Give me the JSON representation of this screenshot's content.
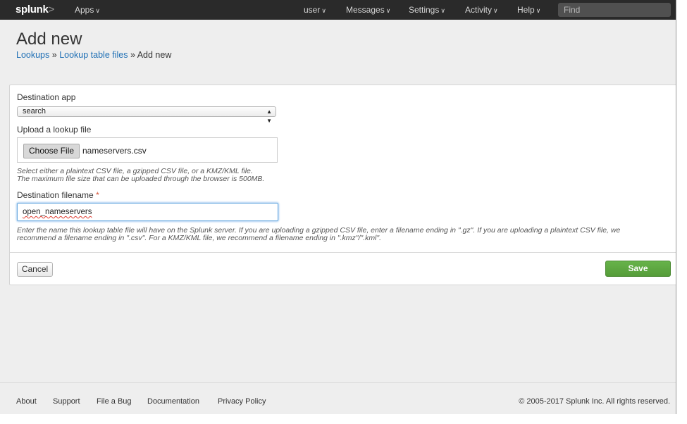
{
  "topbar": {
    "logo": "splunk",
    "logo_mark": ">",
    "nav": [
      {
        "label": "Apps"
      },
      {
        "label": "user"
      },
      {
        "label": "Messages"
      },
      {
        "label": "Settings"
      },
      {
        "label": "Activity"
      },
      {
        "label": "Help"
      }
    ],
    "search_placeholder": "Find"
  },
  "header": {
    "title": "Add new",
    "breadcrumb": [
      {
        "label": "Lookups",
        "link": true
      },
      {
        "label": "Lookup table files",
        "link": true
      },
      {
        "label": "Add new",
        "link": false
      }
    ],
    "separator": "»"
  },
  "form": {
    "destination_app_label": "Destination app",
    "destination_app_value": "search",
    "upload_label": "Upload a lookup file",
    "choose_file_label": "Choose File",
    "chosen_file": "nameservers.csv",
    "upload_help_1": "Select either a plaintext CSV file, a gzipped CSV file, or a KMZ/KML file.",
    "upload_help_2": "The maximum file size that can be uploaded through the browser is 500MB.",
    "filename_label": "Destination filename",
    "required_mark": "*",
    "filename_value": "open_nameservers",
    "filename_help_1": "Enter the name this lookup table file will have on the Splunk server. If you are uploading a gzipped CSV file, enter a filename ending in \".gz\". If you are uploading a plaintext CSV file, we",
    "filename_help_2": "recommend a filename ending in \".csv\". For a KMZ/KML file, we recommend a filename ending in \".kmz\"/\".kml\".",
    "cancel_label": "Cancel",
    "save_label": "Save"
  },
  "footer": {
    "links": [
      {
        "label": "About"
      },
      {
        "label": "Support"
      },
      {
        "label": "File a Bug"
      },
      {
        "label": "Documentation"
      },
      {
        "label": "Privacy Policy"
      }
    ],
    "copyright": "© 2005-2017 Splunk Inc. All rights reserved."
  },
  "colors": {
    "topbar": "#2a2a2a",
    "link": "#1e6fb5",
    "save": "#5ca43f",
    "required": "#d6563c"
  }
}
